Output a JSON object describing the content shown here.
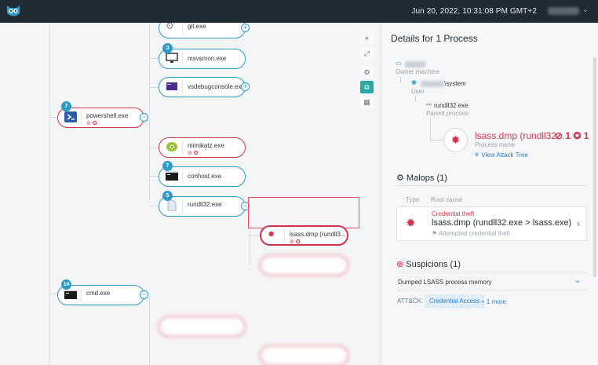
{
  "topbar": {
    "datetime": "Jun 20, 2022, 10:31:08 PM GMT+2",
    "user_chevron": "⌄",
    "logo_icon": "owl-logo-icon"
  },
  "tree": {
    "nodes": [
      {
        "label": "git.exe",
        "badge": "",
        "flags": "",
        "toggle": "+"
      },
      {
        "label": "msvsmon.exe",
        "badge": "3",
        "flags": "",
        "toggle": ""
      },
      {
        "label": "vsdebugconsole.exe",
        "badge": "",
        "flags": "",
        "toggle": "+"
      },
      {
        "label": "powershell.exe",
        "badge": "7",
        "flags": "⊘ ✪",
        "toggle": "−"
      },
      {
        "label": "mimikatz.exe",
        "badge": "",
        "flags": "⊘ ✪",
        "toggle": ""
      },
      {
        "label": "conhost.exe",
        "badge": "7",
        "flags": "",
        "toggle": ""
      },
      {
        "label": "rundll32.exe",
        "badge": "5",
        "flags": "",
        "toggle": "−"
      },
      {
        "label": "lsass.dmp (rundll3...",
        "badge": "",
        "flags": "⊘ ✪",
        "toggle": ""
      },
      {
        "label": "cmd.exe",
        "badge": "14",
        "flags": "",
        "toggle": "−"
      }
    ]
  },
  "tools": [
    {
      "icon": "focus-icon",
      "glyph": "⌖"
    },
    {
      "icon": "expand-icon",
      "glyph": "⤢"
    },
    {
      "icon": "settings-icon",
      "glyph": "⚙"
    },
    {
      "icon": "layers-icon",
      "glyph": "⧉"
    },
    {
      "icon": "grid-icon",
      "glyph": "▦"
    }
  ],
  "panel": {
    "title": "Details for 1 Process",
    "owner_label": "Owner machine",
    "user_suffix": "\\system",
    "user_label": "User",
    "parent_name": "rundll32.exe",
    "parent_label": "Parent process",
    "process_name": "lsass.dmp (rundll32...",
    "process_counts": "⊘ 1   ✪ 1",
    "process_label": "Process name",
    "attack_tree_link": "View Attack Tree",
    "malops_title": "Malops (1)",
    "col_type": "Type",
    "col_root": "Root cause",
    "malop": {
      "type": "Credential theft",
      "root": "lsass.dmp (rundll32.exe > lsass.exe)",
      "sub": "Attempted credential theft",
      "chevron": "›"
    },
    "suspicions_title": "Suspicions (1)",
    "suspicion": "Dumped LSASS process memory",
    "suspicion_chevron": "⌄",
    "attck_label": "ATT&CK:",
    "attck_tag": "Credential Access",
    "attck_more": "+ 1 more"
  },
  "colors": {
    "accent": "#2d9bc7",
    "danger": "#d3344c",
    "topbar": "#1f2a33",
    "tool_active": "#27a9a3"
  }
}
